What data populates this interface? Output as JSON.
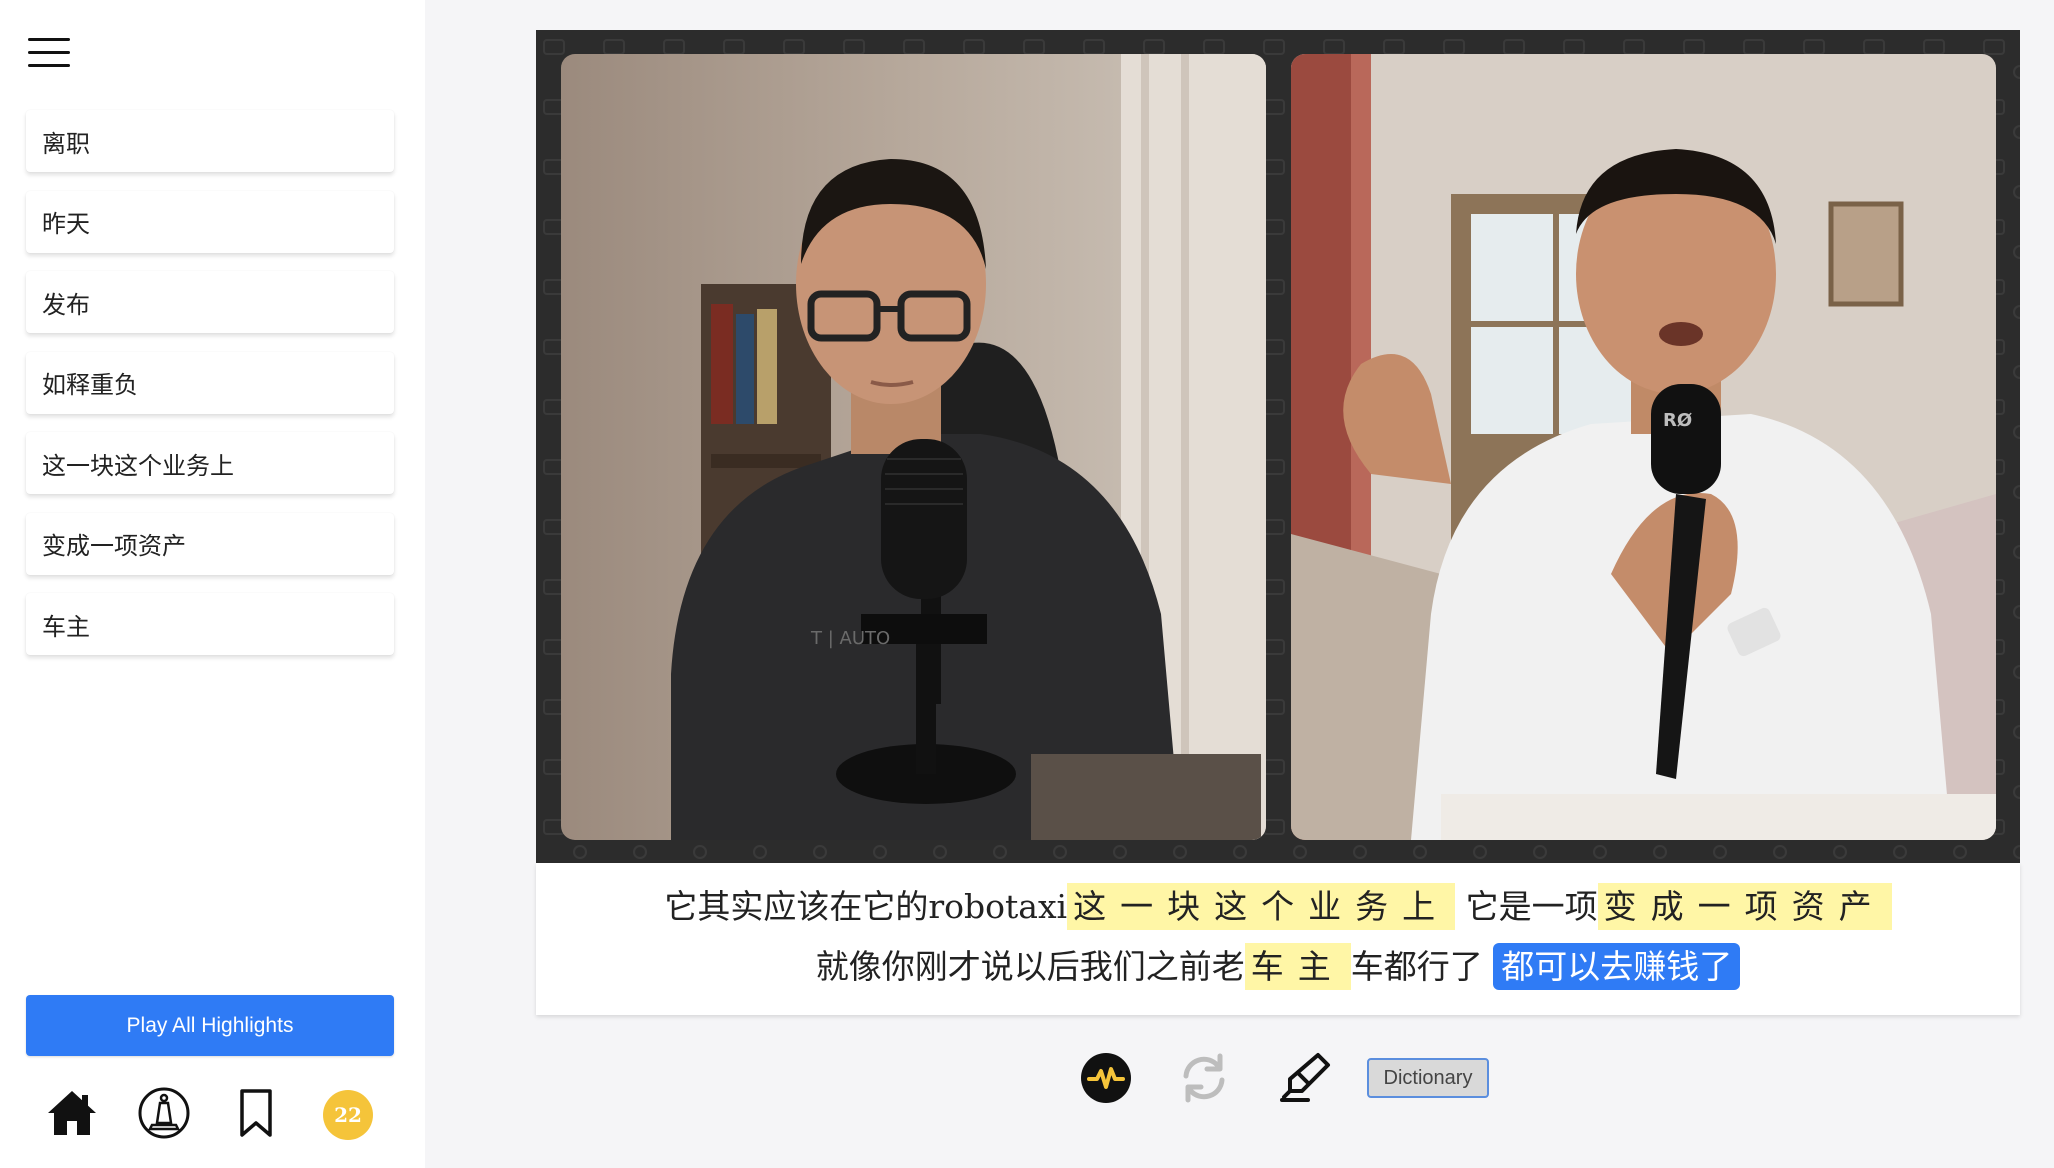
{
  "sidebar": {
    "highlights": [
      {
        "label": "离职"
      },
      {
        "label": "昨天"
      },
      {
        "label": "发布"
      },
      {
        "label": "如释重负"
      },
      {
        "label": "这一块这个业务上"
      },
      {
        "label": "变成一项资产"
      },
      {
        "label": "车主"
      }
    ],
    "play_all_label": "Play All Highlights",
    "nav": {
      "home_icon": "home-icon",
      "study_icon": "study-icon",
      "bookmark_icon": "bookmark-icon",
      "badge_count": "22",
      "badge_color": "#f5c43a"
    }
  },
  "video": {
    "left_speaker_shirt_text": "T | AUTO",
    "right_mic_text": "RØ"
  },
  "subtitles": {
    "line1": {
      "prefix": "它其实应该在它的robotaxi",
      "hl1": "这一块这个业务上",
      "middle": " 它是一项",
      "hl2": "变成一项资产"
    },
    "line2": {
      "prefix": "就像你刚才说以后我们之前老",
      "hl1": "车主",
      "middle": "车都行了 ",
      "current": "都可以去赚钱了"
    },
    "highlight_color": "#fff6a6",
    "current_color": "#2f7bf5"
  },
  "controls": {
    "wave_icon": "waveform-icon",
    "repeat_icon": "repeat-icon",
    "highlighter_icon": "highlighter-icon",
    "dictionary_label": "Dictionary"
  }
}
